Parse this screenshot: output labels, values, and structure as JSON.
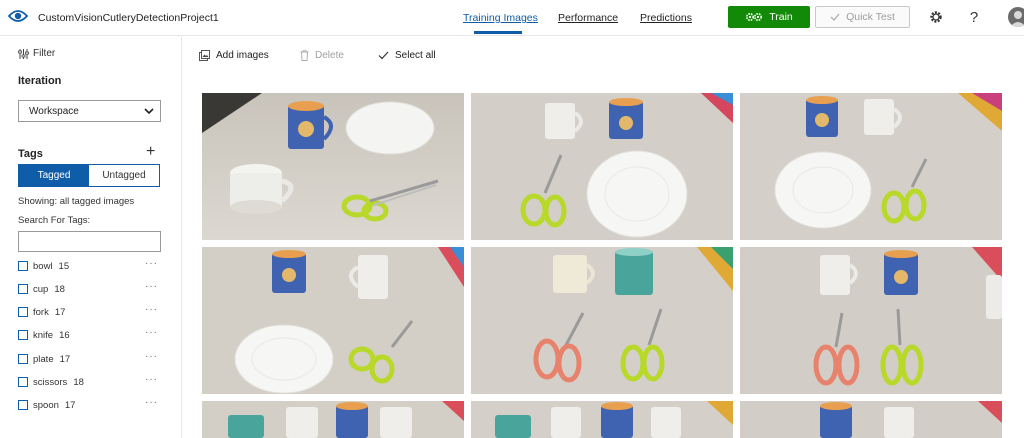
{
  "header": {
    "project_title": "CustomVisionCutleryDetectionProject1",
    "tabs": [
      "Training Images",
      "Performance",
      "Predictions"
    ],
    "train_label": "Train",
    "quick_test_label": "Quick Test",
    "help_label": "?"
  },
  "sidebar": {
    "filter_label": "Filter",
    "iteration_title": "Iteration",
    "iteration_value": "Workspace",
    "tags_title": "Tags",
    "tagged_label": "Tagged",
    "untagged_label": "Untagged",
    "showing_text": "Showing: all tagged images",
    "search_label": "Search For Tags:",
    "tags": [
      {
        "name": "bowl",
        "count": "15"
      },
      {
        "name": "cup",
        "count": "18"
      },
      {
        "name": "fork",
        "count": "17"
      },
      {
        "name": "knife",
        "count": "16"
      },
      {
        "name": "plate",
        "count": "17"
      },
      {
        "name": "scissors",
        "count": "18"
      },
      {
        "name": "spoon",
        "count": "17"
      }
    ]
  },
  "toolbar": {
    "add_images_label": "Add images",
    "delete_label": "Delete",
    "select_all_label": "Select all"
  },
  "colors": {
    "accent": "#0f5da8",
    "train": "#138a07"
  }
}
